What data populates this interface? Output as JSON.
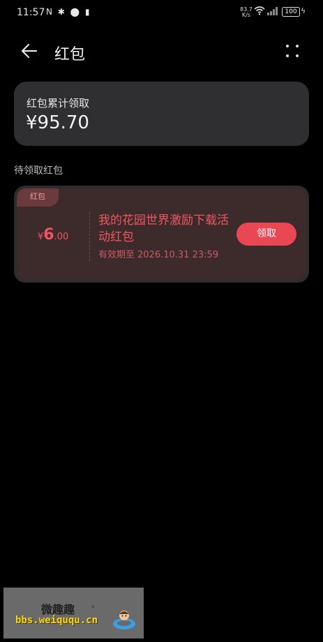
{
  "status_bar": {
    "time": "11:57",
    "left_icons": "NFC ✱ ◉ ▯",
    "net_speed_value": "83.7",
    "net_speed_unit": "K/s",
    "battery": "100"
  },
  "header": {
    "back_icon": "arrow-left-icon",
    "title": "红包",
    "more_icon": "more-vertical-icon"
  },
  "summary": {
    "label": "红包累计领取",
    "amount": "¥95.70"
  },
  "section_title": "待领取红包",
  "coupon": {
    "tag": "红包",
    "currency": "¥",
    "value_int": "6",
    "value_dec": ".00",
    "title": "我的花园世界激励下载活动红包",
    "expiry_prefix": "有效期至",
    "expiry_date": "2026.10.31 23:59",
    "claim_label": "领取"
  },
  "watermark": {
    "title": "微趣趣",
    "url": "bbs.weiququ.cn"
  },
  "colors": {
    "background": "#000000",
    "card": "#2f2f31",
    "coupon_bg": "#3d2b2c",
    "accent_red": "#e84753"
  }
}
